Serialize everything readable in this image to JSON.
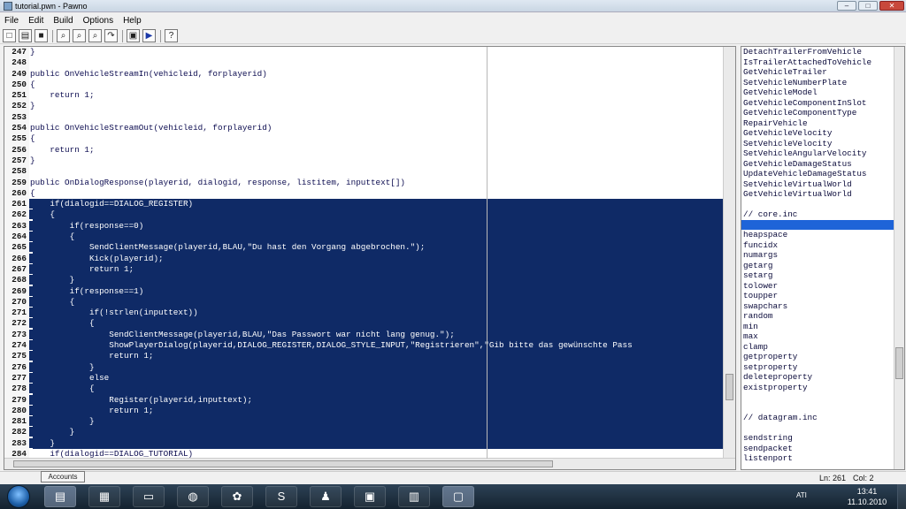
{
  "window": {
    "title": "tutorial.pwn - Pawno",
    "min_label": "–",
    "max_label": "□",
    "close_label": "✕"
  },
  "menu": [
    "File",
    "Edit",
    "Build",
    "Options",
    "Help"
  ],
  "toolbar": {
    "buttons": [
      {
        "name": "new-file-icon",
        "glyph": "□"
      },
      {
        "name": "open-file-icon",
        "glyph": "▤"
      },
      {
        "name": "save-file-icon",
        "glyph": "■"
      },
      {
        "name": "find-icon",
        "glyph": "⌕"
      },
      {
        "name": "find-next-icon",
        "glyph": "⌕"
      },
      {
        "name": "replace-icon",
        "glyph": "⌕"
      },
      {
        "name": "goto-line-icon",
        "glyph": "↷"
      },
      {
        "name": "compile-icon",
        "glyph": "▣"
      },
      {
        "name": "run-icon",
        "glyph": "▶"
      },
      {
        "name": "help-icon",
        "glyph": "?"
      }
    ]
  },
  "code_lines": [
    {
      "num": "247",
      "text": "}",
      "sel": false
    },
    {
      "num": "248",
      "text": "",
      "sel": false
    },
    {
      "num": "249",
      "text": "public OnVehicleStreamIn(vehicleid, forplayerid)",
      "sel": false
    },
    {
      "num": "250",
      "text": "{",
      "sel": false
    },
    {
      "num": "251",
      "text": "    return 1;",
      "sel": false
    },
    {
      "num": "252",
      "text": "}",
      "sel": false
    },
    {
      "num": "253",
      "text": "",
      "sel": false
    },
    {
      "num": "254",
      "text": "public OnVehicleStreamOut(vehicleid, forplayerid)",
      "sel": false
    },
    {
      "num": "255",
      "text": "{",
      "sel": false
    },
    {
      "num": "256",
      "text": "    return 1;",
      "sel": false
    },
    {
      "num": "257",
      "text": "}",
      "sel": false
    },
    {
      "num": "258",
      "text": "",
      "sel": false
    },
    {
      "num": "259",
      "text": "public OnDialogResponse(playerid, dialogid, response, listitem, inputtext[])",
      "sel": false
    },
    {
      "num": "260",
      "text": "{",
      "sel": false
    },
    {
      "num": "261",
      "text": "    if(dialogid==DIALOG_REGISTER)",
      "sel": true
    },
    {
      "num": "262",
      "text": "    {",
      "sel": true
    },
    {
      "num": "263",
      "text": "        if(response==0)",
      "sel": true
    },
    {
      "num": "264",
      "text": "        {",
      "sel": true
    },
    {
      "num": "265",
      "text": "            SendClientMessage(playerid,BLAU,\"Du hast den Vorgang abgebrochen.\");",
      "sel": true
    },
    {
      "num": "266",
      "text": "            Kick(playerid);",
      "sel": true
    },
    {
      "num": "267",
      "text": "            return 1;",
      "sel": true
    },
    {
      "num": "268",
      "text": "        }",
      "sel": true
    },
    {
      "num": "269",
      "text": "        if(response==1)",
      "sel": true
    },
    {
      "num": "270",
      "text": "        {",
      "sel": true
    },
    {
      "num": "271",
      "text": "            if(!strlen(inputtext))",
      "sel": true
    },
    {
      "num": "272",
      "text": "            {",
      "sel": true
    },
    {
      "num": "273",
      "text": "                SendClientMessage(playerid,BLAU,\"Das Passwort war nicht lang genug.\");",
      "sel": true
    },
    {
      "num": "274",
      "text": "                ShowPlayerDialog(playerid,DIALOG_REGISTER,DIALOG_STYLE_INPUT,\"Registrieren\",\"Gib bitte das gewünschte Pass",
      "sel": true
    },
    {
      "num": "275",
      "text": "                return 1;",
      "sel": true
    },
    {
      "num": "276",
      "text": "            }",
      "sel": true
    },
    {
      "num": "277",
      "text": "            else",
      "sel": true
    },
    {
      "num": "278",
      "text": "            {",
      "sel": true
    },
    {
      "num": "279",
      "text": "                Register(playerid,inputtext);",
      "sel": true
    },
    {
      "num": "280",
      "text": "                return 1;",
      "sel": true
    },
    {
      "num": "281",
      "text": "            }",
      "sel": true
    },
    {
      "num": "282",
      "text": "        }",
      "sel": true
    },
    {
      "num": "283",
      "text": "    }",
      "sel": true
    },
    {
      "num": "284",
      "text": "    if(dialogid==DIALOG_TUTORIAL)",
      "sel": false
    }
  ],
  "function_list": [
    {
      "text": "DetachTrailerFromVehicle"
    },
    {
      "text": "IsTrailerAttachedToVehicle"
    },
    {
      "text": "GetVehicleTrailer"
    },
    {
      "text": "SetVehicleNumberPlate"
    },
    {
      "text": "GetVehicleModel"
    },
    {
      "text": "GetVehicleComponentInSlot"
    },
    {
      "text": "GetVehicleComponentType"
    },
    {
      "text": "RepairVehicle"
    },
    {
      "text": "GetVehicleVelocity"
    },
    {
      "text": "SetVehicleVelocity"
    },
    {
      "text": "SetVehicleAngularVelocity"
    },
    {
      "text": "GetVehicleDamageStatus"
    },
    {
      "text": "UpdateVehicleDamageStatus"
    },
    {
      "text": "SetVehicleVirtualWorld"
    },
    {
      "text": "GetVehicleVirtualWorld"
    },
    {
      "text": ""
    },
    {
      "text": " // core.inc"
    },
    {
      "text": "",
      "sel": true
    },
    {
      "text": "heapspace"
    },
    {
      "text": "funcidx"
    },
    {
      "text": "numargs"
    },
    {
      "text": "getarg"
    },
    {
      "text": "setarg"
    },
    {
      "text": "tolower"
    },
    {
      "text": "toupper"
    },
    {
      "text": "swapchars"
    },
    {
      "text": "random"
    },
    {
      "text": "min"
    },
    {
      "text": "max"
    },
    {
      "text": "clamp"
    },
    {
      "text": "getproperty"
    },
    {
      "text": "setproperty"
    },
    {
      "text": "deleteproperty"
    },
    {
      "text": "existproperty"
    },
    {
      "text": ""
    },
    {
      "text": ""
    },
    {
      "text": " // datagram.inc"
    },
    {
      "text": ""
    },
    {
      "text": "sendstring"
    },
    {
      "text": "sendpacket"
    },
    {
      "text": "listenport"
    }
  ],
  "status": {
    "line": "Ln: 261",
    "col": "Col: 2"
  },
  "tooltip": "Accounts",
  "taskbar": {
    "time": "13:41",
    "date": "11.10.2010",
    "tray_text": "ATI"
  }
}
